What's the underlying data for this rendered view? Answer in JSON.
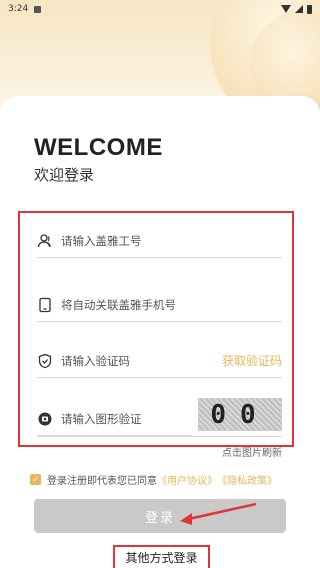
{
  "status_bar": {
    "time": "3:24"
  },
  "header": {
    "title": "WELCOME",
    "subtitle": "欢迎登录"
  },
  "form": {
    "employee_id": {
      "placeholder": "请输入盖雅工号"
    },
    "phone": {
      "placeholder": "将自动关联盖雅手机号"
    },
    "sms_code": {
      "placeholder": "请输入验证码",
      "action_label": "获取验证码"
    },
    "image_code": {
      "placeholder": "请输入图形验证",
      "captcha_text": "00"
    },
    "refresh_tip": "点击图片刷新"
  },
  "agreement": {
    "checked": true,
    "text": "登录注册即代表您已同意",
    "user_agreement": "《用户协议》",
    "privacy_policy": "《隐私政策》"
  },
  "login_button": {
    "label": "登录"
  },
  "other_login": {
    "label": "其他方式登录"
  },
  "colors": {
    "accent": "#e8b55b",
    "highlight_red": "#e0343a",
    "disabled_button": "#c9c9c9"
  },
  "icons": [
    "user-icon",
    "phone-icon",
    "shield-icon",
    "captcha-icon",
    "check-icon"
  ]
}
